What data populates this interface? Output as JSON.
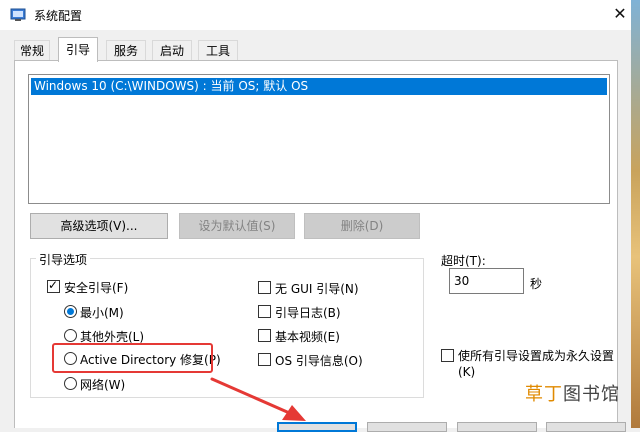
{
  "window": {
    "title": "系统配置",
    "close_glyph": "✕"
  },
  "tabs": [
    {
      "label": "常规",
      "active": false
    },
    {
      "label": "引导",
      "active": true
    },
    {
      "label": "服务",
      "active": false
    },
    {
      "label": "启动",
      "active": false
    },
    {
      "label": "工具",
      "active": false
    }
  ],
  "os_list": {
    "items": [
      "Windows 10 (C:\\WINDOWS) : 当前 OS; 默认 OS"
    ]
  },
  "buttons": {
    "advanced": "高级选项(V)...",
    "set_default": "设为默认值(S)",
    "delete": "删除(D)"
  },
  "boot_options": {
    "label": "引导选项",
    "safe_boot": {
      "label": "安全引导(F)",
      "checked": true
    },
    "minimal": {
      "label": "最小(M)",
      "checked": true
    },
    "alternate_shell": {
      "label": "其他外壳(L)",
      "checked": false
    },
    "ad_repair": {
      "label": "Active Directory 修复(P)",
      "checked": false
    },
    "network": {
      "label": "网络(W)",
      "checked": false
    },
    "no_gui": {
      "label": "无 GUI 引导(N)",
      "checked": false
    },
    "boot_log": {
      "label": "引导日志(B)",
      "checked": false
    },
    "base_video": {
      "label": "基本视频(E)",
      "checked": false
    },
    "os_boot_info": {
      "label": "OS 引导信息(O)",
      "checked": false
    }
  },
  "timeout": {
    "label": "超时(T):",
    "value": "30",
    "unit": "秒"
  },
  "permanent": {
    "label_line1": "使所有引导设置成为永久设置",
    "label_line2": "(K)",
    "checked": false
  },
  "watermark": {
    "part1": "草丁",
    "part2": "图书馆"
  },
  "colors": {
    "selection": "#0078d7",
    "highlight_red": "#e53935",
    "arrow_red": "#e53935"
  }
}
